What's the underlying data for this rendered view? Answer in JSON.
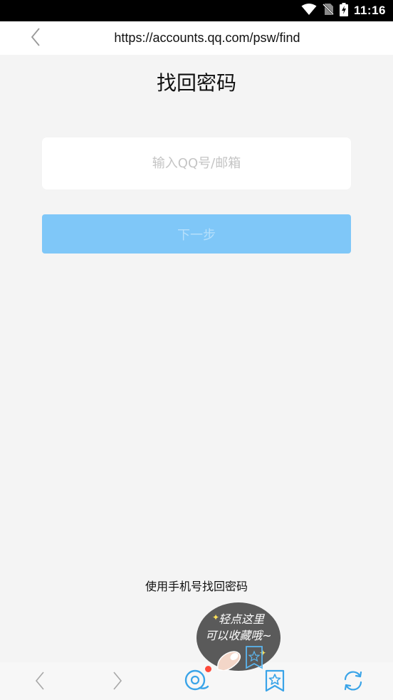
{
  "status_bar": {
    "time": "11:16",
    "icons": [
      "wifi-icon",
      "no-sim-icon",
      "battery-charging-icon"
    ]
  },
  "address_bar": {
    "url": "https://accounts.qq.com/psw/find",
    "back_icon": "chevron-left-icon"
  },
  "page": {
    "title": "找回密码",
    "account_input": {
      "value": "",
      "placeholder": "输入QQ号/邮箱"
    },
    "next_button_label": "下一步",
    "phone_recovery_link": "使用手机号找回密码"
  },
  "tooltip": {
    "line1": "轻点这里",
    "line2": "可以收藏哦~"
  },
  "toolbar": {
    "items": [
      {
        "name": "back",
        "icon": "chevron-left-icon"
      },
      {
        "name": "forward",
        "icon": "chevron-right-icon"
      },
      {
        "name": "home",
        "icon": "qq-browser-icon"
      },
      {
        "name": "bookmark",
        "icon": "bookmark-star-icon"
      },
      {
        "name": "refresh",
        "icon": "refresh-icon"
      }
    ]
  },
  "colors": {
    "accent": "#7fc7f8",
    "toolbar_icon": "#3aa4e8",
    "background": "#f4f4f4"
  }
}
